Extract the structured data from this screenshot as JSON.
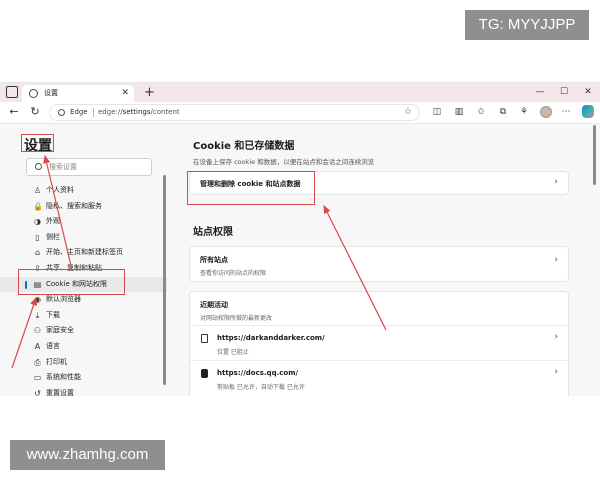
{
  "watermarks": {
    "top": "TG: MYYJJPP",
    "bottom": "www.zhamhg.com"
  },
  "tab": {
    "title": "设置",
    "close": "✕",
    "new_tab": "+"
  },
  "window_controls": [
    "—",
    "☐",
    "✕"
  ],
  "address_bar": {
    "back": "←",
    "reload": "↻",
    "browser_label": "Edge",
    "url_prefix": "edge://",
    "url_bold": "settings",
    "url_suffix": "/content",
    "favorite": "☆"
  },
  "toolbar_icons": [
    "split-screen-icon",
    "favorites-bar-icon",
    "favorites-icon",
    "collections-icon",
    "extensions-icon",
    "profile-icon",
    "more-icon",
    "copilot-icon"
  ],
  "sidebar": {
    "title": "设置",
    "search_placeholder": "搜索设置",
    "items": [
      {
        "label": "个人资料",
        "icon": "user-icon",
        "glyph": "♙"
      },
      {
        "label": "隐私、搜索和服务",
        "icon": "lock-icon",
        "glyph": "🔒"
      },
      {
        "label": "外观",
        "icon": "palette-icon",
        "glyph": "◑"
      },
      {
        "label": "侧栏",
        "icon": "sidebar-icon",
        "glyph": "▯"
      },
      {
        "label": "开始、主页和新建标签页",
        "icon": "home-icon",
        "glyph": "⌂"
      },
      {
        "label": "共享、复制和粘贴",
        "icon": "share-icon",
        "glyph": "⇪"
      },
      {
        "label": "Cookie 和网站权限",
        "icon": "cookie-icon",
        "glyph": "▤",
        "active": true
      },
      {
        "label": "默认浏览器",
        "icon": "browser-icon",
        "glyph": "◉"
      },
      {
        "label": "下载",
        "icon": "download-icon",
        "glyph": "⤓"
      },
      {
        "label": "家庭安全",
        "icon": "family-icon",
        "glyph": "⚇"
      },
      {
        "label": "语言",
        "icon": "language-icon",
        "glyph": "A"
      },
      {
        "label": "打印机",
        "icon": "printer-icon",
        "glyph": "⎙"
      },
      {
        "label": "系统和性能",
        "icon": "system-icon",
        "glyph": "▭"
      },
      {
        "label": "重置设置",
        "icon": "reset-icon",
        "glyph": "↺"
      }
    ]
  },
  "content": {
    "cookie_section": {
      "title": "Cookie 和已存储数据",
      "desc": "在设备上保存 cookie 和数据，以便在站点和会话之间连续浏览",
      "manage_label": "管理和删除 cookie 和站点数据",
      "chevron": "›"
    },
    "permissions_section": {
      "title": "站点权限",
      "all_sites_label": "所有站点",
      "all_sites_desc": "查看你访问的站点的权限",
      "recent_label": "近期活动",
      "recent_desc": "对网站权限所做的最新更改",
      "sites": [
        {
          "url": "https://darkanddarker.com/",
          "detail": "位置 已阻止",
          "icon": "document-icon"
        },
        {
          "url": "https://docs.qq.com/",
          "detail": "剪贴板 已允许，自动下载 已允许",
          "icon": "tencent-docs-icon"
        }
      ],
      "chevron": "›"
    }
  },
  "annotation_color": "#d9484e"
}
